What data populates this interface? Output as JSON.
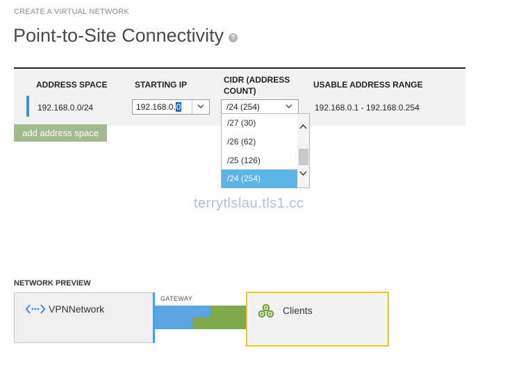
{
  "header": {
    "crumb": "CREATE A VIRTUAL NETWORK",
    "title": "Point-to-Site Connectivity",
    "help_icon": "help-icon"
  },
  "table": {
    "headers": {
      "address_space": "ADDRESS SPACE",
      "starting_ip": "STARTING IP",
      "cidr": "CIDR (ADDRESS COUNT)",
      "usable_range": "USABLE ADDRESS RANGE"
    },
    "row": {
      "address_space": "192.168.0.0/24",
      "starting_ip_prefix": "192.168.0.",
      "starting_ip_selected": "0",
      "cidr_value": "/24 (254)",
      "usable_range": "192.168.0.1 - 192.168.0.254"
    }
  },
  "cidr_dropdown": {
    "options": [
      "/27 (30)",
      "/26 (62)",
      "/25 (126)",
      "/24 (254)"
    ],
    "selected_index": 3
  },
  "add_button": "add address space",
  "watermark": "terrytlslau.tls1.cc",
  "preview": {
    "label": "NETWORK PREVIEW",
    "vpn_network": "VPNNetwork",
    "gateway": "GATEWAY",
    "clients": "Clients"
  },
  "colors": {
    "accent_blue": "#5aa4e0",
    "accent_green": "#7fa84a",
    "selection": "#5bb4e5",
    "highlight_border": "#f2c416",
    "button_green": "#a3b98e"
  }
}
